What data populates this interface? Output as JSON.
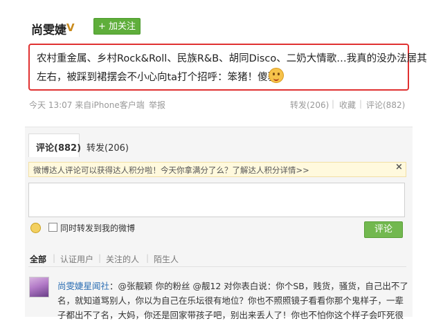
{
  "header": {
    "author_name": "尚雯婕",
    "verified_badge": "V",
    "follow_button": "+ 加关注"
  },
  "post": {
    "line1": "农村重金属、乡村Rock&Roll、民族R&B、胡同Disco、二奶大情歌…我真的没办法居其",
    "line2": "左右，被踩到裙摆会不小心向ta打个招呼：笨猪！傻驴！",
    "emoji": "smiling-face-icon"
  },
  "meta": {
    "time_source": "今天 13:07 来自iPhone客户端",
    "report": "举报",
    "repost": "转发(206)",
    "favorite": "收藏",
    "comments": "评论(882)",
    "separator": "|"
  },
  "comment_panel": {
    "tab_comment": "评论(882)",
    "tab_repost": "转发(206)",
    "notice": "微博达人评论可以获得达人积分啦！今天你拿满分了么？了解达人积分详情>>",
    "notice_close": "×",
    "checkbox_label": "同时转发到我的微博",
    "submit": "评论"
  },
  "filters": {
    "all": "全部",
    "verified": "认证用户",
    "following": "关注的人",
    "strangers": "陌生人",
    "separator": "|"
  },
  "comment": {
    "user": "尚雯婕星闻社",
    "line1_rest": "：@张靓颖 你的粉丝 @靓12 对你表白说：你个SB，贱货，骚货，自己出不了",
    "line2": "名，就知道骂别人，你以为自己在乐坛很有地位？你也不照照镜子看看你那个鬼样子，一辈",
    "line3": "子都出不了名，大妈，你还是回家带孩子吧，别出来丢人了！你也不怕你这个样子会吓死很"
  },
  "colors": {
    "highlight_border": "#e03030",
    "follow_green": "#5fae3b",
    "link_blue": "#2a6db3"
  }
}
